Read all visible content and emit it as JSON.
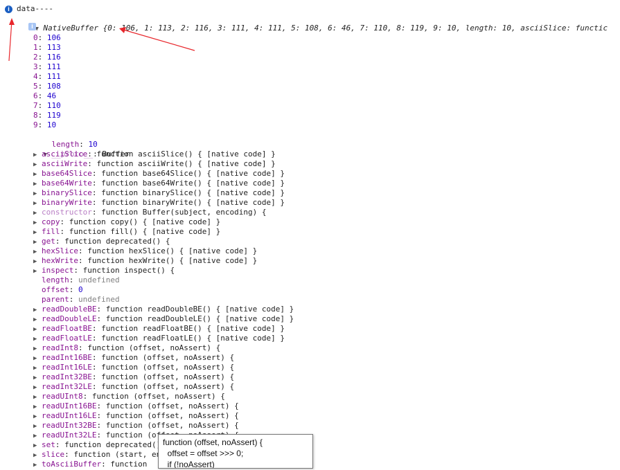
{
  "header": {
    "log_label": "data----",
    "object_summary": "NativeBuffer {0: 106, 1: 113, 2: 116, 3: 111, 4: 111, 5: 108, 6: 46, 7: 110, 8: 119, 9: 10, length: 10, asciiSlice: functic"
  },
  "icons": {
    "info": "i",
    "expand_collapse": "▼",
    "collapsed": "▶"
  },
  "indices": [
    {
      "key": "0",
      "value": "106"
    },
    {
      "key": "1",
      "value": "113"
    },
    {
      "key": "2",
      "value": "116"
    },
    {
      "key": "3",
      "value": "111"
    },
    {
      "key": "4",
      "value": "111"
    },
    {
      "key": "5",
      "value": "108"
    },
    {
      "key": "6",
      "value": "46"
    },
    {
      "key": "7",
      "value": "110"
    },
    {
      "key": "8",
      "value": "119"
    },
    {
      "key": "9",
      "value": "10"
    }
  ],
  "length_row": {
    "key": "length",
    "value": "10"
  },
  "proto": {
    "key": "__proto__",
    "value": "Buffer"
  },
  "proto_members": [
    {
      "key": "asciiSlice",
      "value": "function asciiSlice() { [native code] }",
      "expandable": true
    },
    {
      "key": "asciiWrite",
      "value": "function asciiWrite() { [native code] }",
      "expandable": true
    },
    {
      "key": "base64Slice",
      "value": "function base64Slice() { [native code] }",
      "expandable": true
    },
    {
      "key": "base64Write",
      "value": "function base64Write() { [native code] }",
      "expandable": true
    },
    {
      "key": "binarySlice",
      "value": "function binarySlice() { [native code] }",
      "expandable": true
    },
    {
      "key": "binaryWrite",
      "value": "function binaryWrite() { [native code] }",
      "expandable": true
    },
    {
      "key": "constructor",
      "value": "function Buffer(subject, encoding) {",
      "expandable": true,
      "dim": true
    },
    {
      "key": "copy",
      "value": "function copy() { [native code] }",
      "expandable": true
    },
    {
      "key": "fill",
      "value": "function fill() { [native code] }",
      "expandable": true
    },
    {
      "key": "get",
      "value": "function deprecated() {",
      "expandable": true
    },
    {
      "key": "hexSlice",
      "value": "function hexSlice() { [native code] }",
      "expandable": true
    },
    {
      "key": "hexWrite",
      "value": "function hexWrite() { [native code] }",
      "expandable": true
    },
    {
      "key": "inspect",
      "value": "function inspect() {",
      "expandable": true
    },
    {
      "key": "length",
      "value": "undefined",
      "expandable": false,
      "kind": "undef"
    },
    {
      "key": "offset",
      "value": "0",
      "expandable": false,
      "kind": "num"
    },
    {
      "key": "parent",
      "value": "undefined",
      "expandable": false,
      "kind": "undef"
    },
    {
      "key": "readDoubleBE",
      "value": "function readDoubleBE() { [native code] }",
      "expandable": true
    },
    {
      "key": "readDoubleLE",
      "value": "function readDoubleLE() { [native code] }",
      "expandable": true
    },
    {
      "key": "readFloatBE",
      "value": "function readFloatBE() { [native code] }",
      "expandable": true
    },
    {
      "key": "readFloatLE",
      "value": "function readFloatLE() { [native code] }",
      "expandable": true
    },
    {
      "key": "readInt8",
      "value": "function (offset, noAssert) {",
      "expandable": true
    },
    {
      "key": "readInt16BE",
      "value": "function (offset, noAssert) {",
      "expandable": true
    },
    {
      "key": "readInt16LE",
      "value": "function (offset, noAssert) {",
      "expandable": true
    },
    {
      "key": "readInt32BE",
      "value": "function (offset, noAssert) {",
      "expandable": true
    },
    {
      "key": "readInt32LE",
      "value": "function (offset, noAssert) {",
      "expandable": true
    },
    {
      "key": "readUInt8",
      "value": "function (offset, noAssert) {",
      "expandable": true
    },
    {
      "key": "readUInt16BE",
      "value": "function (offset, noAssert) {",
      "expandable": true
    },
    {
      "key": "readUInt16LE",
      "value": "function (offset, noAssert) {",
      "expandable": true
    },
    {
      "key": "readUInt32BE",
      "value": "function (offset, noAssert) {",
      "expandable": true
    },
    {
      "key": "readUInt32LE",
      "value": "function (offset, noAssert) {",
      "expandable": true
    },
    {
      "key": "set",
      "value": "function deprecated() {",
      "expandable": true
    },
    {
      "key": "slice",
      "value": "function (start, end) {",
      "expandable": true
    },
    {
      "key": "toAsciiBuffer",
      "value": "function",
      "expandable": true
    }
  ],
  "tooltip": {
    "line1": "function (offset, noAssert) {",
    "line2": "  offset = offset >>> 0;",
    "line3": "  if (!noAssert)"
  },
  "colors": {
    "arrow": "#e8262b",
    "key": "#881391",
    "number": "#1c00cf",
    "undefined": "#808080",
    "info_blue": "#1a5ec2"
  }
}
